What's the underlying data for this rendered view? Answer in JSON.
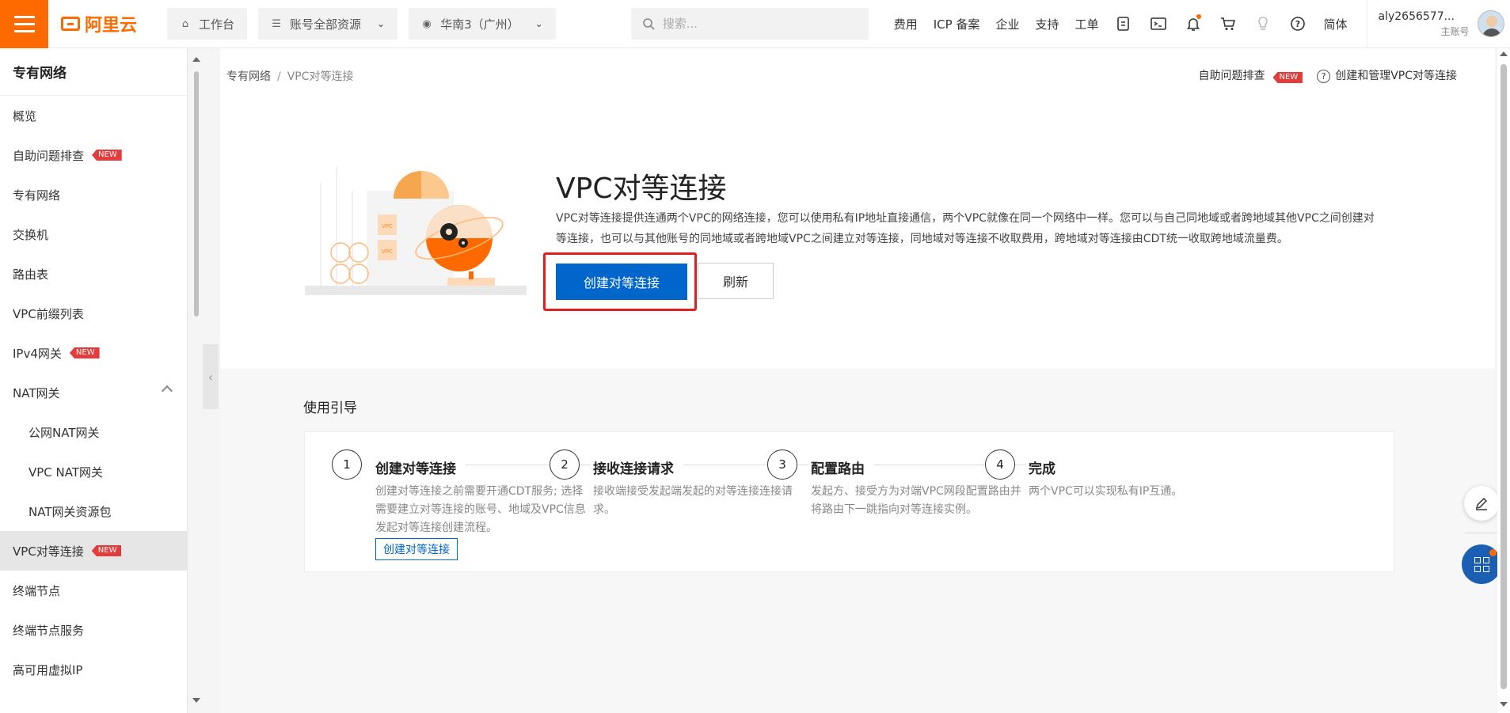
{
  "topbar": {
    "logo_text": "阿里云",
    "workbench": "工作台",
    "resources": "账号全部资源",
    "region": "华南3（广州）",
    "search_placeholder": "搜索...",
    "links": [
      "费用",
      "ICP 备案",
      "企业",
      "支持",
      "工单"
    ],
    "lang": "简体",
    "account_name": "aly2656577...",
    "account_type": "主账号"
  },
  "sidebar": {
    "title": "专有网络",
    "items": [
      {
        "label": "概览",
        "badge": "",
        "sub": false,
        "active": false
      },
      {
        "label": "自助问题排查",
        "badge": "NEW",
        "sub": false,
        "active": false
      },
      {
        "label": "专有网络",
        "badge": "",
        "sub": false,
        "active": false
      },
      {
        "label": "交换机",
        "badge": "",
        "sub": false,
        "active": false
      },
      {
        "label": "路由表",
        "badge": "",
        "sub": false,
        "active": false
      },
      {
        "label": "VPC前缀列表",
        "badge": "",
        "sub": false,
        "active": false
      },
      {
        "label": "IPv4网关",
        "badge": "NEW",
        "sub": false,
        "active": false
      },
      {
        "label": "NAT网关",
        "badge": "",
        "sub": false,
        "active": false,
        "expandable": true
      },
      {
        "label": "公网NAT网关",
        "badge": "",
        "sub": true,
        "active": false
      },
      {
        "label": "VPC NAT网关",
        "badge": "",
        "sub": true,
        "active": false
      },
      {
        "label": "NAT网关资源包",
        "badge": "",
        "sub": true,
        "active": false
      },
      {
        "label": "VPC对等连接",
        "badge": "NEW",
        "sub": false,
        "active": true
      },
      {
        "label": "终端节点",
        "badge": "",
        "sub": false,
        "active": false
      },
      {
        "label": "终端节点服务",
        "badge": "",
        "sub": false,
        "active": false
      },
      {
        "label": "高可用虚拟IP",
        "badge": "",
        "sub": false,
        "active": false
      }
    ]
  },
  "breadcrumb": {
    "parent": "专有网络",
    "current": "VPC对等连接"
  },
  "header_links": {
    "troubleshoot": "自助问题排查",
    "badge": "NEW",
    "help": "创建和管理VPC对等连接"
  },
  "hero": {
    "title": "VPC对等连接",
    "description": "VPC对等连接提供连通两个VPC的网络连接，您可以使用私有IP地址直接通信，两个VPC就像在同一个网络中一样。您可以与自己同地域或者跨地域其他VPC之间创建对等连接，也可以与其他账号的同地域或者跨地域VPC之间建立对等连接，同地域对等连接不收取费用，跨地域对等连接由CDT统一收取跨地域流量费。",
    "primary_button": "创建对等连接",
    "refresh_button": "刷新",
    "illustration_label": "VPC"
  },
  "guide": {
    "title": "使用引导",
    "steps": [
      {
        "num": "1",
        "title": "创建对等连接",
        "desc": "创建对等连接之前需要开通CDT服务; 选择需要建立对等连接的账号、地域及VPC信息发起对等连接创建流程。",
        "link": "创建对等连接"
      },
      {
        "num": "2",
        "title": "接收连接请求",
        "desc": "接收端接受发起端发起的对等连接连接请求。"
      },
      {
        "num": "3",
        "title": "配置路由",
        "desc": "发起方、接受方为对端VPC网段配置路由并将路由下一跳指向对等连接实例。"
      },
      {
        "num": "4",
        "title": "完成",
        "desc": "两个VPC可以实现私有IP互通。"
      }
    ]
  },
  "colors": {
    "brand": "#ff6a00",
    "primary": "#0066cc",
    "new_badge": "#e43b3b",
    "highlight": "#e02020"
  }
}
